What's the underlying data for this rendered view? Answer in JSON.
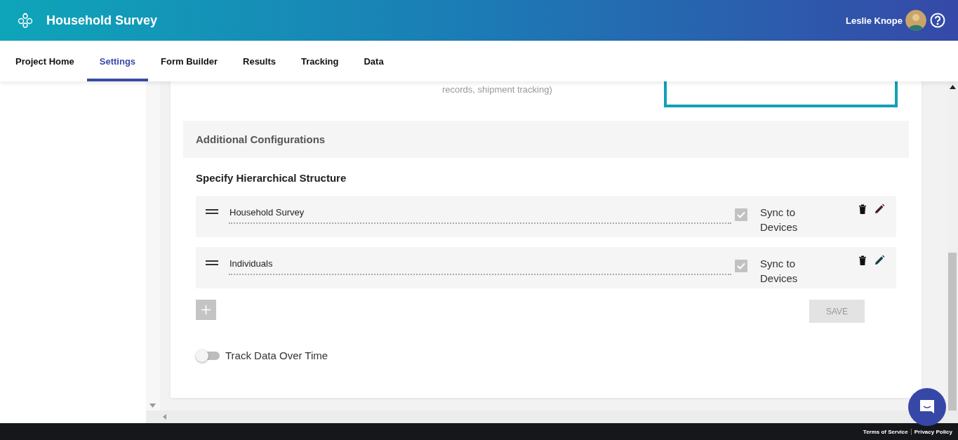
{
  "header": {
    "title": "Household Survey",
    "user_name": "Leslie Knope"
  },
  "tabs": [
    {
      "label": "Project Home",
      "selected": false
    },
    {
      "label": "Settings",
      "selected": true
    },
    {
      "label": "Form Builder",
      "selected": false
    },
    {
      "label": "Results",
      "selected": false
    },
    {
      "label": "Tracking",
      "selected": false
    },
    {
      "label": "Data",
      "selected": false
    }
  ],
  "description": {
    "text": "records, shipment tracking)"
  },
  "section": {
    "title": "Additional Configurations"
  },
  "hierarchy": {
    "title": "Specify Hierarchical Structure",
    "save_label": "SAVE",
    "levels": [
      {
        "name": "Household Survey",
        "sync_label": "Sync to Devices",
        "checked": true
      },
      {
        "name": "Individuals",
        "sync_label": "Sync to Devices",
        "checked": true
      }
    ]
  },
  "track_toggle": {
    "label": "Track Data Over Time",
    "on": false
  },
  "footer": {
    "links": [
      "Terms of Service",
      "Privacy Policy"
    ]
  }
}
